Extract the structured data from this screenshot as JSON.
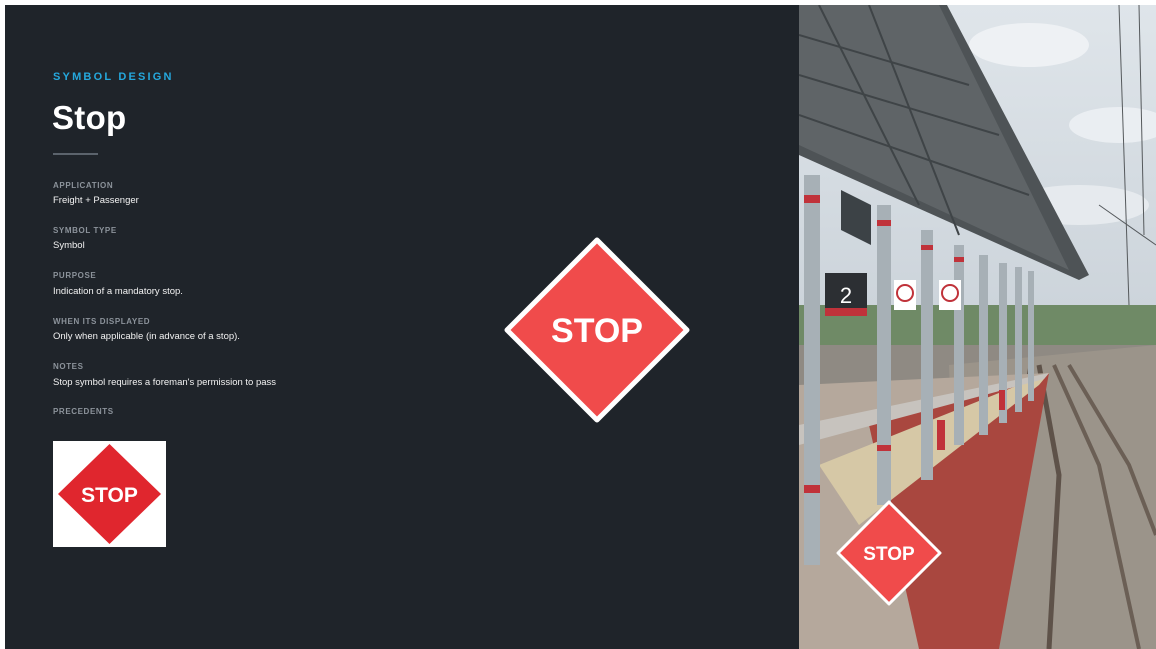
{
  "header": {
    "eyebrow": "SYMBOL DESIGN",
    "title": "Stop"
  },
  "fields": [
    {
      "label": "APPLICATION",
      "value": "Freight + Passenger"
    },
    {
      "label": "SYMBOL TYPE",
      "value": "Symbol"
    },
    {
      "label": "PURPOSE",
      "value": "Indication of a mandatory stop."
    },
    {
      "label": "WHEN ITS DISPLAYED",
      "value": "Only when applicable (in advance of a stop)."
    },
    {
      "label": "NOTES",
      "value": "Stop symbol requires a foreman's permission to pass"
    }
  ],
  "precedents": {
    "label": "PRECEDENTS",
    "sign_text": "STOP"
  },
  "main_symbol": {
    "text": "STOP"
  },
  "photo": {
    "platform_number": "2",
    "sign_overlay_text": "STOP"
  },
  "colors": {
    "background": "#1f242a",
    "accent": "#25a8dd",
    "stop_red": "#f04b4b",
    "precedent_red": "#e0262e"
  }
}
